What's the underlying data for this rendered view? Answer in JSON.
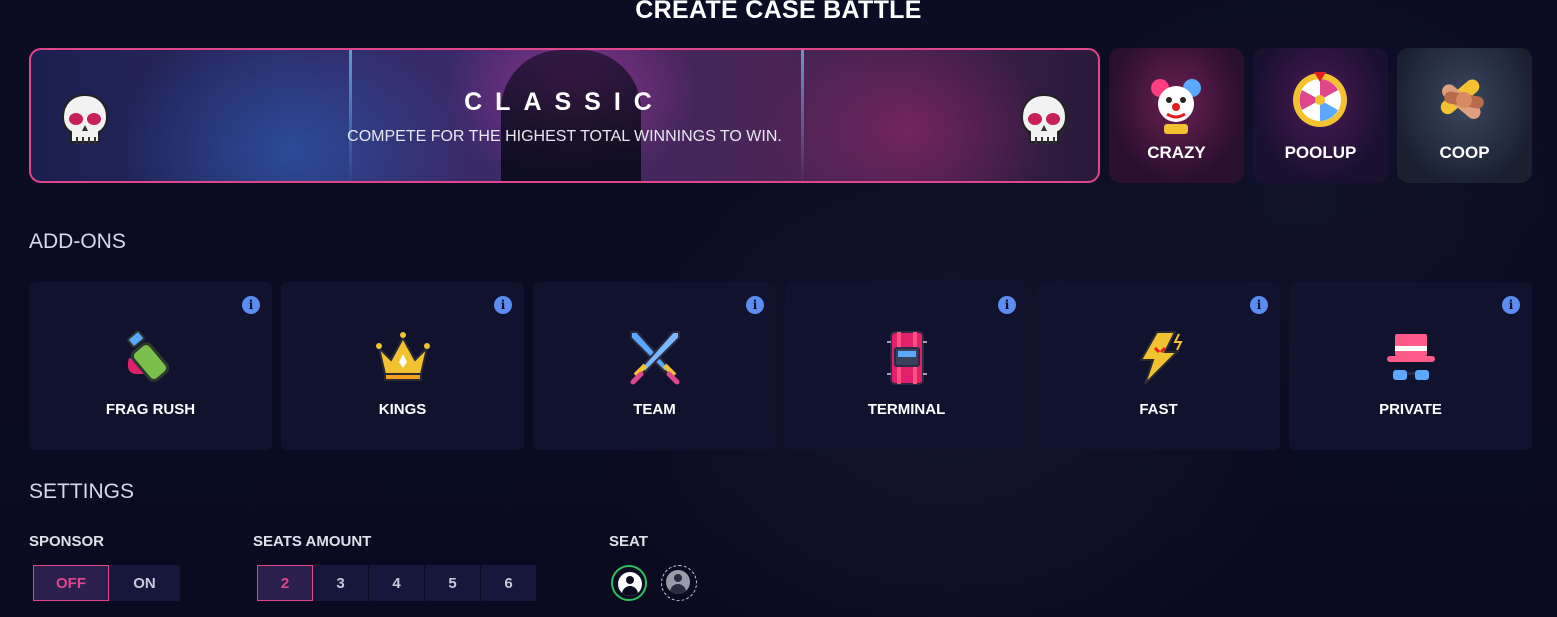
{
  "page_title": "CREATE CASE BATTLE",
  "selected_mode": {
    "title": "CLASSIC",
    "description": "COMPETE FOR THE HIGHEST TOTAL WINNINGS TO WIN."
  },
  "modes": [
    {
      "label": "CRAZY",
      "icon": "clown-icon"
    },
    {
      "label": "POOLUP",
      "icon": "wheel-icon"
    },
    {
      "label": "COOP",
      "icon": "handshake-icon"
    }
  ],
  "addons_section": {
    "title": "ADD-ONS",
    "items": [
      {
        "label": "FRAG RUSH",
        "icon": "grenade-icon",
        "info": "i"
      },
      {
        "label": "KINGS",
        "icon": "crown-icon",
        "info": "i"
      },
      {
        "label": "TEAM",
        "icon": "crossed-swords-icon",
        "info": "i"
      },
      {
        "label": "TERMINAL",
        "icon": "bomb-icon",
        "info": "i"
      },
      {
        "label": "FAST",
        "icon": "lightning-icon",
        "info": "i"
      },
      {
        "label": "PRIVATE",
        "icon": "hat-glasses-icon",
        "info": "i"
      }
    ]
  },
  "settings": {
    "title": "SETTINGS",
    "sponsor": {
      "label": "SPONSOR",
      "options": [
        "OFF",
        "ON"
      ],
      "selected": "OFF"
    },
    "seats_amount": {
      "label": "SEATS AMOUNT",
      "options": [
        "2",
        "3",
        "4",
        "5",
        "6"
      ],
      "selected": "2"
    },
    "seat": {
      "label": "SEAT"
    }
  },
  "colors": {
    "accent": "#e0468a",
    "background": "#0b0c22",
    "card": "#11122e",
    "info": "#5b8cf0",
    "seat_active": "#2fbf5a"
  }
}
